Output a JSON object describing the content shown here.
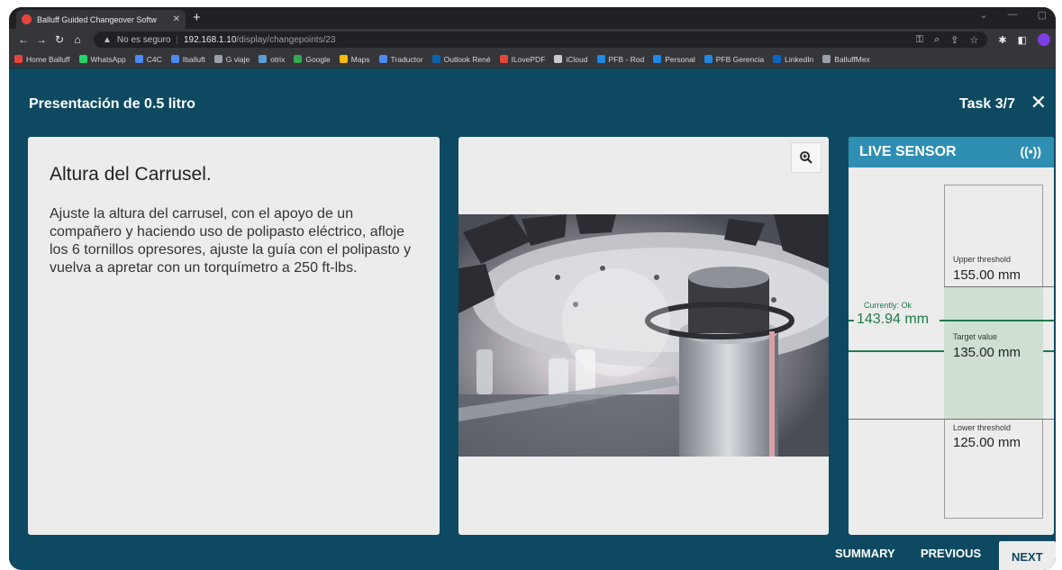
{
  "browser": {
    "tab_title": "Balluff Guided Changeover Softw",
    "address_insecure": "No es seguro",
    "address_host": "192.168.1.10",
    "address_path": "/display/changepoints/23",
    "bookmarks": [
      {
        "label": "Home Balluff",
        "color": "#e8453c"
      },
      {
        "label": "WhatsApp",
        "color": "#25d366"
      },
      {
        "label": "C4C",
        "color": "#4c8bf5"
      },
      {
        "label": "Iballuft",
        "color": "#4c8bf5"
      },
      {
        "label": "G viaje",
        "color": "#9aa0a6"
      },
      {
        "label": "otrix",
        "color": "#5a9bd4"
      },
      {
        "label": "Google",
        "color": "#34a853"
      },
      {
        "label": "Maps",
        "color": "#fbbc05"
      },
      {
        "label": "Traductor",
        "color": "#4c8bf5"
      },
      {
        "label": "Outlook René",
        "color": "#0a64ad"
      },
      {
        "label": "ILovePDF",
        "color": "#e8453c"
      },
      {
        "label": "iCloud",
        "color": "#c9cacc"
      },
      {
        "label": "PFB - Rod",
        "color": "#1e88e5"
      },
      {
        "label": "Personal",
        "color": "#1e88e5"
      },
      {
        "label": "PFB Gerencia",
        "color": "#1e88e5"
      },
      {
        "label": "LinkedIn",
        "color": "#0a66c2"
      },
      {
        "label": "BalluffMex",
        "color": "#9aa0a6"
      }
    ]
  },
  "app": {
    "title": "Presentación de 0.5 litro",
    "task": "Task 3/7",
    "close_glyph": "✕"
  },
  "step": {
    "title": "Altura del Carrusel.",
    "body": "Ajuste la altura del carrusel, con el apoyo de un compañero y haciendo uso de polipasto eléctrico, afloje los 6 tornillos opresores, ajuste la guía con el polipasto y vuelva a apretar con un torquímetro a 250 ft-lbs."
  },
  "sensor": {
    "header": "LIVE SENSOR",
    "upper_label": "Upper threshold",
    "upper_value": "155.00 mm",
    "current_label": "Currently: Ok",
    "current_value": "143.94 mm",
    "target_label": "Target value",
    "target_value": "135.00 mm",
    "lower_label": "Lower threshold",
    "lower_value": "125.00 mm"
  },
  "footer": {
    "summary": "SUMMARY",
    "previous": "PREVIOUS",
    "next": "NEXT"
  },
  "icons": {
    "zoom": "zoom-in-icon",
    "live": "broadcast-icon"
  }
}
